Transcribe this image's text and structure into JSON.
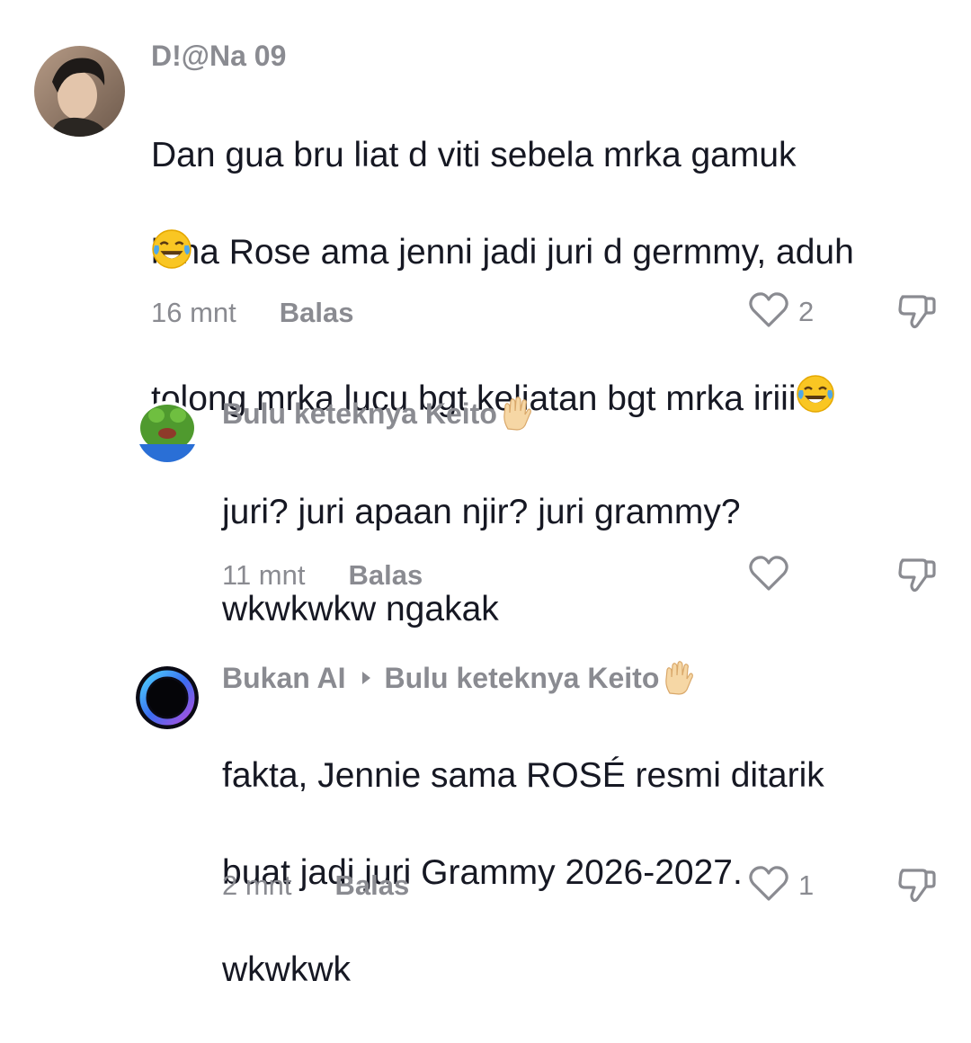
{
  "comments": [
    {
      "username": "D!@Na 09",
      "text_lines": [
        "Dan gua bru liat d viti sebela mrka gamuk",
        "krna Rose ama jenni jadi juri d germmy, aduh",
        "tolong mrka lucu bgt keliatan bgt mrka iriii"
      ],
      "time": "16 mnt",
      "reply_label": "Balas",
      "like_count": "2",
      "icons": {
        "avatar": "profile-photo",
        "trailing_emoji": "tears-of-joy-emoji",
        "like": "heart-outline-icon",
        "dislike": "thumbs-down-outline-icon"
      }
    },
    {
      "username": "Bulu keteknya Keito",
      "text_lines": [
        "juri? juri apaan njir? juri grammy?",
        "wkwkwkw ngakak"
      ],
      "time": "11 mnt",
      "reply_label": "Balas",
      "like_count": "",
      "icons": {
        "avatar": "green-frog-avatar",
        "name_emoji": "raised-hand-emoji",
        "like": "heart-outline-icon",
        "dislike": "thumbs-down-outline-icon"
      }
    },
    {
      "username": "Bukan AI",
      "reply_to": "Bulu keteknya Keito",
      "text_lines": [
        "fakta, Jennie sama ROSÉ resmi ditarik",
        "buat jadi juri Grammy 2026-2027.",
        "wkwkwk"
      ],
      "time": "2 mnt",
      "reply_label": "Balas",
      "like_count": "1",
      "icons": {
        "avatar": "ai-ring-avatar",
        "reply_arrow": "caret-right-icon",
        "name_emoji": "raised-hand-emoji",
        "like": "heart-outline-icon",
        "dislike": "thumbs-down-outline-icon"
      }
    }
  ],
  "colors": {
    "text": "#161823",
    "meta": "#8a8b91",
    "background": "#ffffff"
  }
}
